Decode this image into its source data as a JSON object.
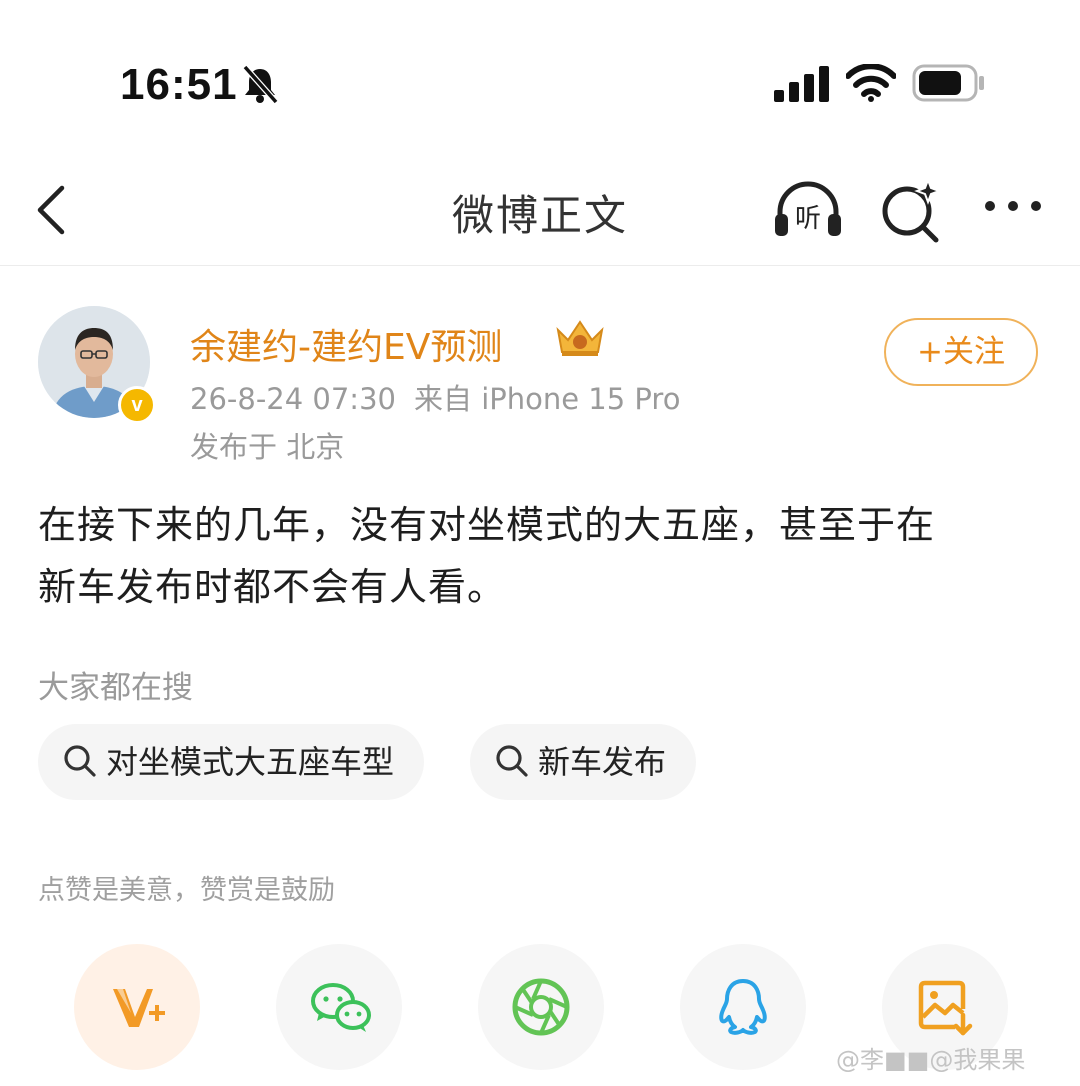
{
  "status_bar": {
    "time": "16:51",
    "icons": [
      "bell-mute-icon",
      "signal-icon",
      "wifi-icon",
      "battery-icon"
    ]
  },
  "nav": {
    "title": "微博正文",
    "listen_label": "听",
    "icons": [
      "back-icon",
      "listen-icon",
      "ai-search-icon",
      "more-icon"
    ]
  },
  "post": {
    "author": "余建约-建约EV预测",
    "verified_mark": "v",
    "time": "26-8-24 07:30",
    "source": "来自 iPhone 15 Pro",
    "location": "发布于 北京",
    "follow_label": "+关注",
    "body_line1": "在接下来的几年，没有对坐模式的大五座，甚至于在",
    "body_line2": "新车发布时都不会有人看。"
  },
  "search": {
    "title": "大家都在搜",
    "chips": [
      {
        "label": "对坐模式大五座车型"
      },
      {
        "label": "新车发布"
      }
    ]
  },
  "reward": {
    "title": "点赞是美意，赞赏是鼓励",
    "buttons": [
      "vplus-icon",
      "wechat-icon",
      "moments-icon",
      "qq-icon",
      "save-image-icon"
    ]
  },
  "watermark": "@李■■@我果果",
  "colors": {
    "author": "#e08518",
    "follow": "#e98a1a",
    "meta": "#9a9a9a",
    "wechat": "#3cc15a",
    "moments": "#62c455",
    "qq": "#2aa3e6",
    "save": "#f0a020"
  }
}
